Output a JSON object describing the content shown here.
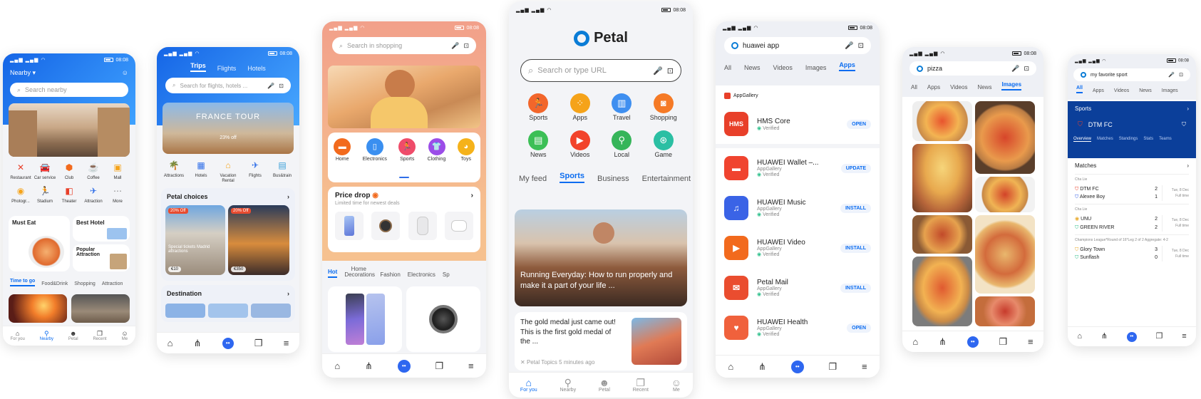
{
  "common": {
    "time": "08:08",
    "signal": "▂▄▆ ▂▄▆ ◠"
  },
  "p1": {
    "location": "Nearby",
    "search": "Search nearby",
    "categories": [
      "Restaurant",
      "Car service",
      "Club",
      "Coffee",
      "Mall",
      "Photogr...",
      "Stadium",
      "Theater",
      "Attraction",
      "More"
    ],
    "must_eat": "Must Eat",
    "best_hotel": "Best Hotel",
    "popular_attraction": "Popular Attraction",
    "tabs": [
      "Time to go",
      "Food&Drink",
      "Shopping",
      "Attraction"
    ],
    "nav": [
      "For you",
      "Nearby",
      "Petal",
      "Recent",
      "Me"
    ]
  },
  "p2": {
    "tabs": [
      "Trips",
      "Flights",
      "Hotels"
    ],
    "search": "Search for flights, hotels ...",
    "banner_title": "FRANCE TOUR",
    "banner_sub": "23% off",
    "cats": [
      "Attractions",
      "Hotels",
      "Vacation Rental",
      "Flights",
      "Bus&train"
    ],
    "choices_title": "Petal choices",
    "badge": "20% Off",
    "card1_text": "Special tickets Madrid attractions",
    "price1": "€10",
    "price2": "€350",
    "destination": "Destination"
  },
  "p3": {
    "search": "Search in shopping",
    "cats": [
      "Home",
      "Electronics",
      "Sports",
      "Clothing",
      "Toys"
    ],
    "price_drop": "Price drop",
    "price_sub": "Limited time for newest deals",
    "tabs": [
      "Hot",
      "Home Decorations",
      "Fashion",
      "Electronics",
      "Sp"
    ]
  },
  "p4": {
    "logo": "Petal",
    "search": "Search or type URL",
    "shortcuts": [
      "Sports",
      "Apps",
      "Travel",
      "Shopping",
      "News",
      "Videos",
      "Local",
      "Game"
    ],
    "feed_tabs": [
      "My feed",
      "Sports",
      "Business",
      "Entertainment"
    ],
    "headline": "Running Everyday: How to run properly and make it a part of your life ...",
    "article": "The gold medal just came out! This is the first gold medal of the ...",
    "source": "Petal Topics",
    "time_ago": "5 minutes ago",
    "nav": [
      "For you",
      "Nearby",
      "Petal",
      "Recent",
      "Me"
    ]
  },
  "p5": {
    "query": "huawei app",
    "tabs": [
      "All",
      "News",
      "Videos",
      "Images",
      "Apps"
    ],
    "appgallery": "AppGallery",
    "apps": [
      {
        "name": "HMS Core",
        "sub": "",
        "verified": "Verified",
        "action": "OPEN",
        "color": "#e8402a",
        "icon": "HMS"
      },
      {
        "name": "HUAWEI Wallet –...",
        "sub": "AppGallery",
        "verified": "Verified",
        "action": "UPDATE",
        "color": "#f0442f",
        "icon": "▬"
      },
      {
        "name": "HUAWEI Music",
        "sub": "AppGallery",
        "verified": "Verified",
        "action": "INSTALL",
        "color": "#3a63e6",
        "icon": "♫"
      },
      {
        "name": "HUAWEI Video",
        "sub": "AppGallery",
        "verified": "Verified",
        "action": "INSTALL",
        "color": "#f26a1d",
        "icon": "▶"
      },
      {
        "name": "Petal Mail",
        "sub": "AppGallery",
        "verified": "Verified",
        "action": "INSTALL",
        "color": "#ea4d2f",
        "icon": "✉"
      },
      {
        "name": "HUAWEI Health",
        "sub": "AppGallery",
        "verified": "Verified",
        "action": "OPEN",
        "color": "#f0613c",
        "icon": "♥"
      }
    ]
  },
  "p6": {
    "query": "pizza",
    "tabs": [
      "All",
      "Apps",
      "Videos",
      "News",
      "Images"
    ]
  },
  "p7": {
    "query": "my favorite sport",
    "tabs": [
      "All",
      "Apps",
      "Videos",
      "News",
      "Images"
    ],
    "sports": "Sports",
    "team": "DTM FC",
    "team_tabs": [
      "Overview",
      "Matches",
      "Standings",
      "Stats",
      "Teams"
    ],
    "matches": "Matches",
    "groups": [
      {
        "league": "Cha Lie",
        "rows": [
          [
            "DTM FC",
            "2"
          ],
          [
            "Alexee Boy",
            "1"
          ]
        ],
        "date": "Tue, 8 Dec",
        "status": "Full time"
      },
      {
        "league": "Cha Lie",
        "rows": [
          [
            "UNU",
            "2"
          ],
          [
            "GREEN RIVER",
            "2"
          ]
        ],
        "date": "Tue, 8 Dec",
        "status": "Full time"
      },
      {
        "league": "Champions League*Round of 16*Leg 2 of 2 Aggregate: 4-2",
        "rows": [
          [
            "Glory Town",
            "3"
          ],
          [
            "Sunflash",
            "0"
          ]
        ],
        "date": "Tue, 8 Dec",
        "status": "Full time"
      }
    ]
  }
}
